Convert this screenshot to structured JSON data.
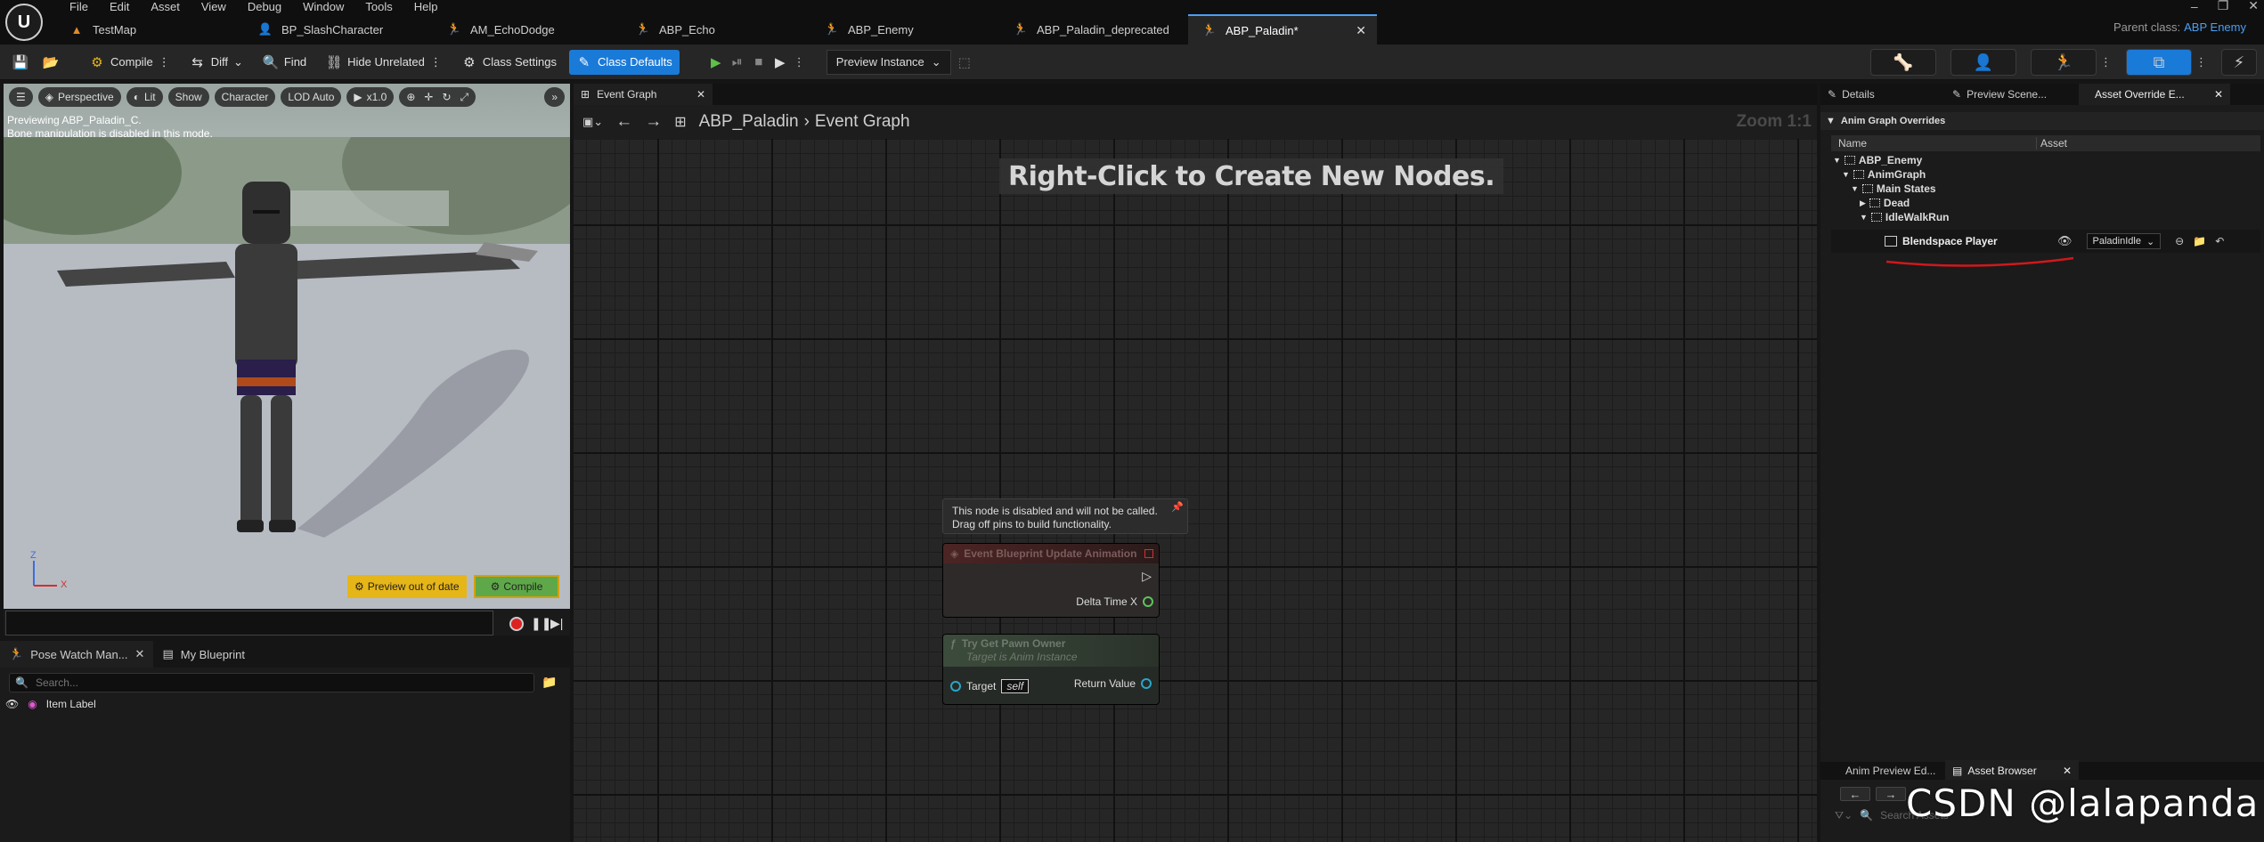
{
  "menu": [
    "File",
    "Edit",
    "Asset",
    "View",
    "Debug",
    "Window",
    "Tools",
    "Help"
  ],
  "doc_tabs": [
    {
      "label": "TestMap",
      "icon": "map-icon"
    },
    {
      "label": "BP_SlashCharacter",
      "icon": "blueprint-icon"
    },
    {
      "label": "AM_EchoDodge",
      "icon": "anim-montage-icon"
    },
    {
      "label": "ABP_Echo",
      "icon": "anim-blueprint-icon"
    },
    {
      "label": "ABP_Enemy",
      "icon": "anim-blueprint-icon"
    },
    {
      "label": "ABP_Paladin_deprecated",
      "icon": "anim-blueprint-icon"
    },
    {
      "label": "ABP_Paladin*",
      "icon": "anim-blueprint-icon"
    }
  ],
  "parent_class": {
    "label": "Parent class:",
    "value": "ABP Enemy"
  },
  "toolbar": {
    "compile": "Compile",
    "diff": "Diff",
    "find": "Find",
    "hide_unrelated": "Hide Unrelated",
    "class_settings": "Class Settings",
    "class_defaults": "Class Defaults",
    "preview_instance": "Preview Instance"
  },
  "viewport": {
    "perspective": "Perspective",
    "lit": "Lit",
    "show": "Show",
    "character": "Character",
    "lod": "LOD Auto",
    "speed": "x1.0",
    "msg1": "Previewing ABP_Paladin_C.",
    "msg2": "Bone manipulation is disabled in this mode.",
    "preview_out_of_date": "Preview out of date",
    "compile": "Compile",
    "axis_z": "Z",
    "axis_x": "X"
  },
  "pose_watch": {
    "tab1": "Pose Watch Man...",
    "tab2": "My Blueprint",
    "search_placeholder": "Search...",
    "item_label": "Item Label"
  },
  "graph": {
    "tab": "Event Graph",
    "breadcrumb_root": "ABP_Paladin",
    "breadcrumb_leaf": "Event Graph",
    "zoom": "Zoom 1:1",
    "hint": "Right-Click to Create New Nodes.",
    "disabled_line1": "This node is disabled and will not be called.",
    "disabled_line2": "Drag off pins to build functionality.",
    "node1_title": "Event Blueprint Update Animation",
    "node1_pin": "Delta Time X",
    "node2_title": "Try Get Pawn Owner",
    "node2_subtitle": "Target is Anim Instance",
    "node2_target": "Target",
    "node2_self": "self",
    "node2_return": "Return Value"
  },
  "right_panel": {
    "tabs": [
      "Details",
      "Preview Scene...",
      "Asset Override E..."
    ],
    "section": "Anim Graph Overrides",
    "col_name": "Name",
    "col_asset": "Asset",
    "tree": [
      "ABP_Enemy",
      "AnimGraph",
      "Main States",
      "Dead",
      "IdleWalkRun"
    ],
    "blendspace": "Blendspace Player",
    "asset_value": "PaladinIdle"
  },
  "bottom_right": {
    "tab1": "Anim Preview Ed...",
    "tab2": "Asset Browser",
    "search_placeholder": "Search Assets"
  },
  "watermark": "CSDN @lalapanda",
  "colors": {
    "accent": "#1a7ad8",
    "annotation": "#d0181c",
    "warning": "#e6b517",
    "compile": "#5fa84a"
  }
}
